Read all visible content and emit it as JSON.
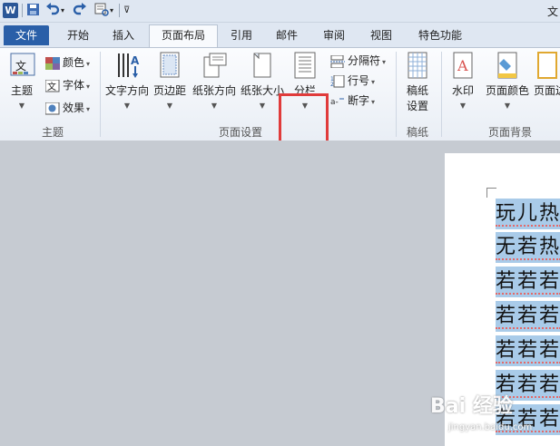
{
  "quick_access": {
    "app_icon_letter": "W",
    "title_fragment": "文"
  },
  "tabs": [
    {
      "label": "文件"
    },
    {
      "label": "开始"
    },
    {
      "label": "插入"
    },
    {
      "label": "页面布局"
    },
    {
      "label": "引用"
    },
    {
      "label": "邮件"
    },
    {
      "label": "审阅"
    },
    {
      "label": "视图"
    },
    {
      "label": "特色功能"
    }
  ],
  "ribbon": {
    "theme_group": {
      "label": "主题",
      "themes_button": "主题",
      "colors": "颜色",
      "fonts": "字体",
      "effects": "效果"
    },
    "page_setup_group": {
      "label": "页面设置",
      "text_direction": "文字方向",
      "margins": "页边距",
      "orientation": "纸张方向",
      "size": "纸张大小",
      "columns": "分栏",
      "breaks": "分隔符",
      "line_numbers": "行号",
      "hyphenation": "断字"
    },
    "manuscript_group": {
      "label": "稿纸",
      "settings_line1": "稿纸",
      "settings_line2": "设置"
    },
    "background_group": {
      "label": "页面背景",
      "watermark": "水印",
      "page_color": "页面颜色",
      "page_borders": "页面边"
    }
  },
  "document": {
    "lines": [
      "玩儿热",
      "无若热",
      "若若若",
      "若若若",
      "若若若",
      "若若若",
      "若若若"
    ]
  },
  "watermark": {
    "brand": "Bai 经验",
    "url": "jingyan.baidu.com"
  },
  "colors": {
    "file_tab": "#2a5fa8",
    "highlight_box": "#e03b3b",
    "selection": "#a9cbe9"
  }
}
